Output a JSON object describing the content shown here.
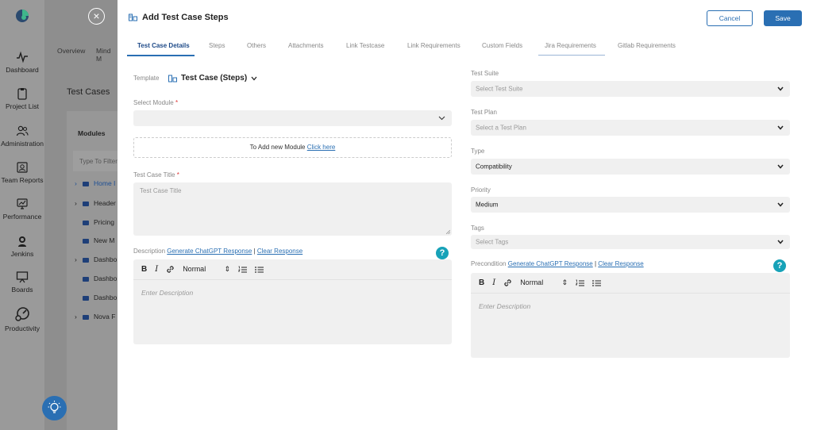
{
  "nav": {
    "items": [
      {
        "label": "Dashboard"
      },
      {
        "label": "Project List"
      },
      {
        "label": "Administration"
      },
      {
        "label": "Team Reports"
      },
      {
        "label": "Performance"
      },
      {
        "label": "Jenkins"
      },
      {
        "label": "Boards"
      },
      {
        "label": "Productivity"
      }
    ]
  },
  "background": {
    "tabs": [
      "Overview",
      "Mind M"
    ],
    "title": "Test Cases",
    "modules_header": "Modules",
    "filter_placeholder": "Type To Filter",
    "rows": [
      {
        "label": "Home I",
        "caret": "›",
        "highlight": true
      },
      {
        "label": "Header",
        "caret": "›",
        "highlight": false
      },
      {
        "label": "Pricing",
        "caret": "",
        "highlight": false
      },
      {
        "label": "New M",
        "caret": "",
        "highlight": false
      },
      {
        "label": "Dashbo",
        "caret": "›",
        "highlight": false
      },
      {
        "label": "Dashbo",
        "caret": "",
        "highlight": false
      },
      {
        "label": "Dashbo",
        "caret": "",
        "highlight": false
      },
      {
        "label": "Nova F",
        "caret": "›",
        "highlight": false
      }
    ]
  },
  "modal": {
    "title": "Add Test Case Steps",
    "cancel_label": "Cancel",
    "save_label": "Save",
    "tabs": [
      {
        "label": "Test Case Details",
        "active": true
      },
      {
        "label": "Steps"
      },
      {
        "label": "Others"
      },
      {
        "label": "Attachments"
      },
      {
        "label": "Link Testcase"
      },
      {
        "label": "Link Requirements"
      },
      {
        "label": "Custom Fields"
      },
      {
        "label": "Jira Requirements"
      },
      {
        "label": "Gitlab Requirements"
      }
    ],
    "left": {
      "template_label": "Template",
      "template_value": "Test Case (Steps)",
      "module_label": "Select Module",
      "module_value": "",
      "add_module_text": "To Add new Module",
      "add_module_link": "Click here",
      "title_label": "Test Case Title",
      "title_placeholder": "Test Case Title",
      "description_label": "Description",
      "gen_link": "Generate ChatGPT Response",
      "separator": "|",
      "clear_link": "Clear Response",
      "editor": {
        "bold": "B",
        "italic": "I",
        "format": "Normal",
        "placeholder": "Enter Description"
      }
    },
    "right": {
      "suite_label": "Test Suite",
      "suite_placeholder": "Select Test Suite",
      "plan_label": "Test Plan",
      "plan_placeholder": "Select a Test Plan",
      "type_label": "Type",
      "type_value": "Compatibility",
      "priority_label": "Priority",
      "priority_value": "Medium",
      "tags_label": "Tags",
      "tags_placeholder": "Select Tags",
      "precondition_label": "Precondition",
      "gen_link": "Generate ChatGPT Response",
      "separator": "|",
      "clear_link": "Clear Response",
      "editor": {
        "bold": "B",
        "italic": "I",
        "format": "Normal",
        "placeholder": "Enter Description"
      }
    },
    "help_glyph": "?",
    "required_mark": "*",
    "close_glyph": "×"
  },
  "colors": {
    "accent": "#2a6fb3",
    "help": "#17a2b8"
  }
}
